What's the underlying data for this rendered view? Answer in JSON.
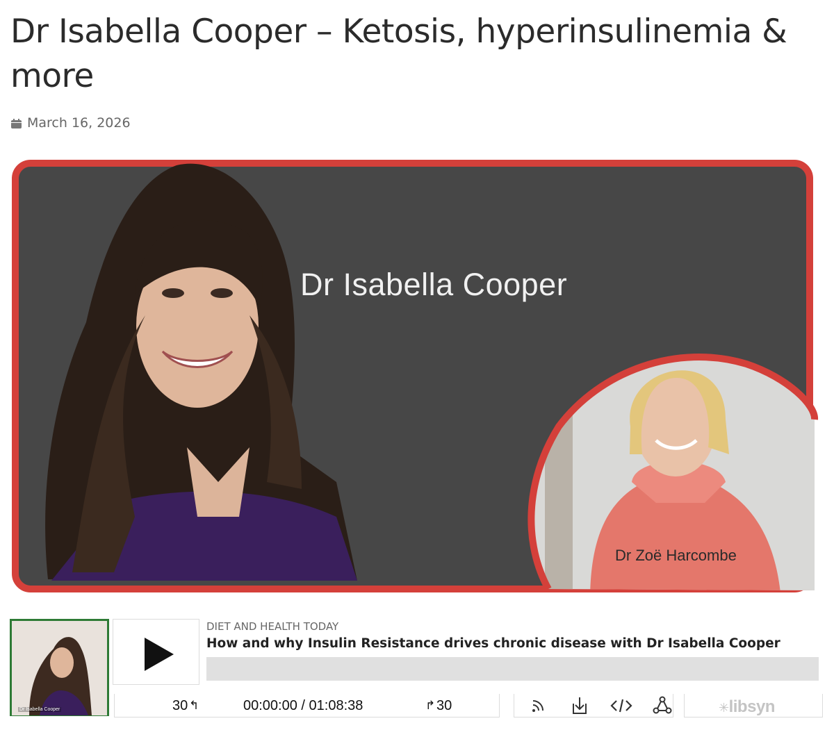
{
  "post": {
    "title": "Dr Isabella Cooper – Ketosis, hyperinsulinemia & more",
    "date": "March 16, 2026",
    "date_icon": "calendar-icon"
  },
  "banner": {
    "guest_name": "Dr Isabella Cooper",
    "host_name": "Dr Zoë Harcombe",
    "frame_color": "#d4403a",
    "background_color": "#474747"
  },
  "player": {
    "thumbnail_caption": "Dr Isabella Cooper",
    "show_name": "DIET AND HEALTH TODAY",
    "episode_title": "How and why Insulin Resistance drives chronic disease with Dr Isabella Cooper",
    "rewind_label": "30",
    "forward_label": "30",
    "time_display": "00:00:00 / 01:08:38",
    "progress": 0,
    "icons": [
      "rss-icon",
      "download-icon",
      "embed-icon",
      "share-icon"
    ],
    "brand": "libsyn"
  }
}
